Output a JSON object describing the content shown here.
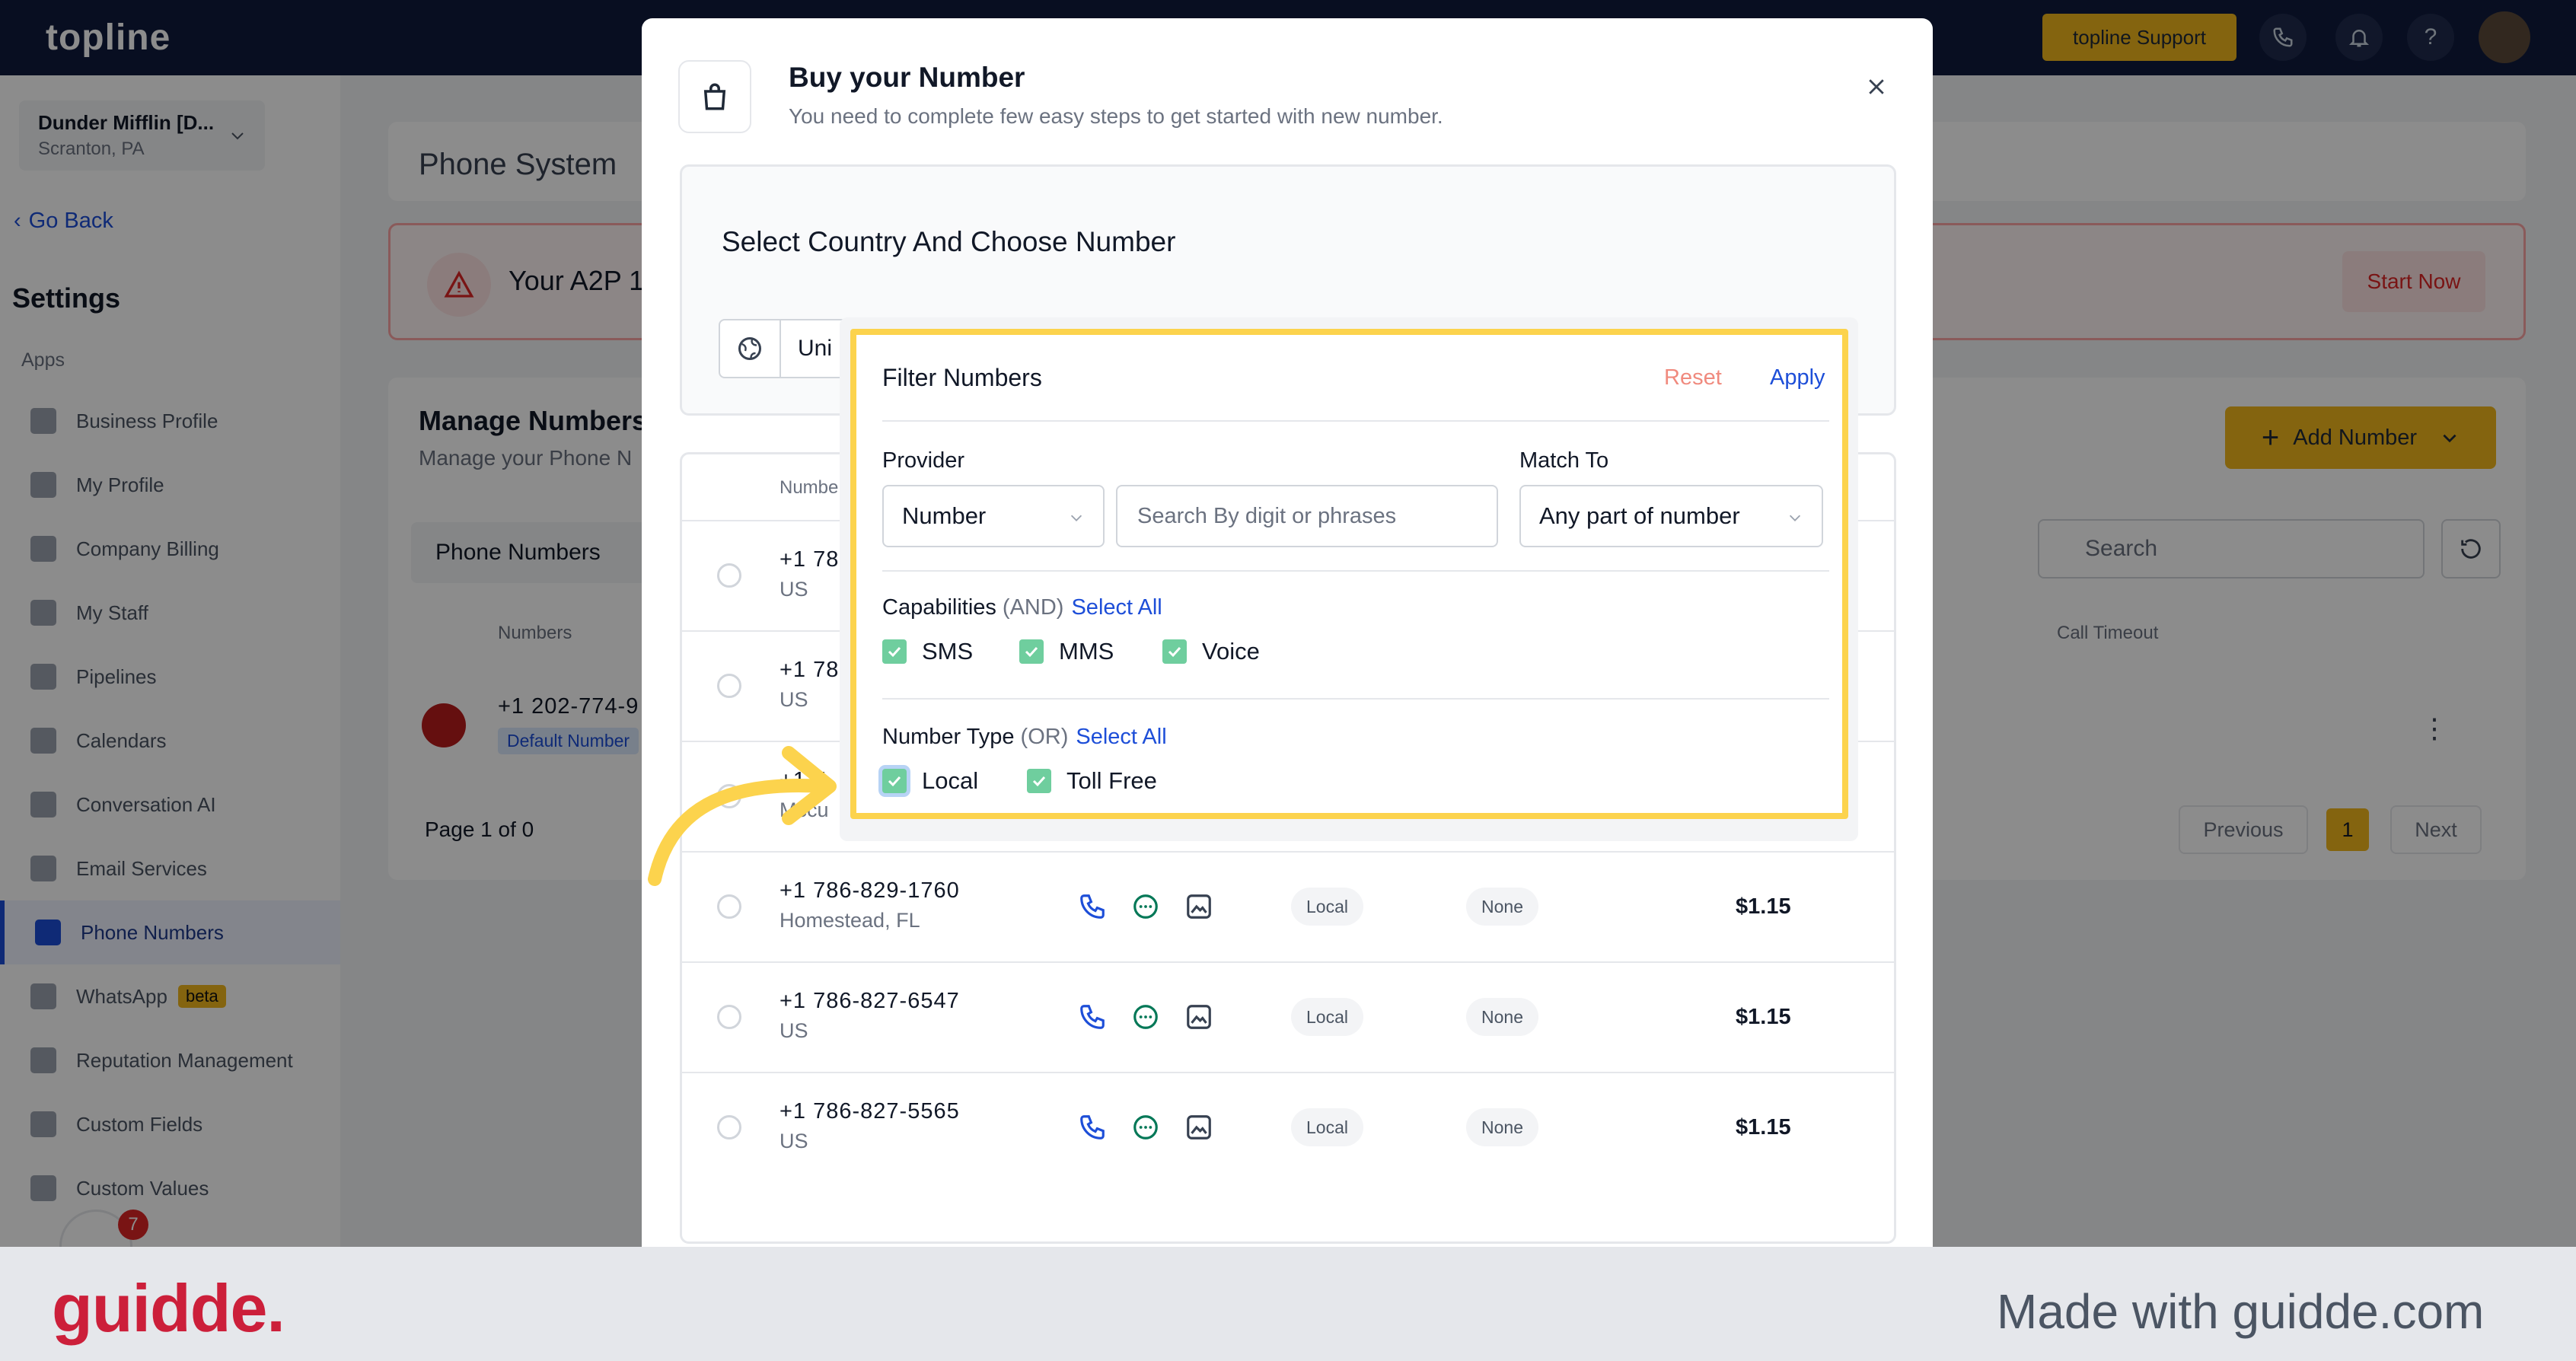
{
  "topbar": {
    "logo": "topline",
    "support_label": "topline Support"
  },
  "sidebar": {
    "account_name": "Dunder Mifflin [D...",
    "account_location": "Scranton, PA",
    "go_back": "Go Back",
    "settings_title": "Settings",
    "apps_label": "Apps",
    "items": [
      {
        "label": "Business Profile",
        "icon": "briefcase-icon"
      },
      {
        "label": "My Profile",
        "icon": "user-icon"
      },
      {
        "label": "Company Billing",
        "icon": "billing-icon"
      },
      {
        "label": "My Staff",
        "icon": "staff-icon"
      },
      {
        "label": "Pipelines",
        "icon": "pipeline-icon"
      },
      {
        "label": "Calendars",
        "icon": "calendar-icon"
      },
      {
        "label": "Conversation AI",
        "icon": "chat-icon"
      },
      {
        "label": "Email Services",
        "icon": "mail-icon"
      },
      {
        "label": "Phone Numbers",
        "icon": "phone-icon",
        "active": true
      },
      {
        "label": "WhatsApp",
        "icon": "whatsapp-icon",
        "badge": "beta"
      },
      {
        "label": "Reputation Management",
        "icon": "star-icon"
      },
      {
        "label": "Custom Fields",
        "icon": "edit-icon"
      },
      {
        "label": "Custom Values",
        "icon": "values-icon"
      }
    ],
    "notification_count": "7"
  },
  "background": {
    "page_title": "Phone System",
    "a2p_text": "Your A2P 1",
    "start_now": "Start Now",
    "manage_title": "Manage Numbers",
    "manage_sub": "Manage your Phone N",
    "add_number": "Add Number",
    "tab_phone_numbers": "Phone Numbers",
    "search_placeholder": "Search",
    "col_numbers": "Numbers",
    "col_call_timeout": "Call Timeout",
    "row_number": "+1 202-774-9",
    "row_badge": "Default Number",
    "pagination": {
      "page_text": "Page 1 of 0",
      "previous": "Previous",
      "current": "1",
      "next": "Next"
    }
  },
  "modal": {
    "title": "Buy your Number",
    "subtitle": "You need to complete few easy steps to get started with new number.",
    "step_title": "Select Country And Choose Number",
    "country_value": "Uni",
    "table_header_number": "Numbe",
    "rows_partial": [
      {
        "number": "+1 78",
        "location": "US"
      },
      {
        "number": "+1 78",
        "location": "US"
      },
      {
        "number": "+1 7",
        "location": "Mccu"
      }
    ],
    "rows": [
      {
        "number": "+1 786-829-1760",
        "location": "Homestead, FL",
        "type": "Local",
        "extra": "None",
        "price": "$1.15"
      },
      {
        "number": "+1 786-827-6547",
        "location": "US",
        "type": "Local",
        "extra": "None",
        "price": "$1.15"
      },
      {
        "number": "+1 786-827-5565",
        "location": "US",
        "type": "Local",
        "extra": "None",
        "price": "$1.15"
      }
    ]
  },
  "filter": {
    "title": "Filter Numbers",
    "reset": "Reset",
    "apply": "Apply",
    "provider_label": "Provider",
    "provider_value": "Number",
    "search_placeholder": "Search By digit or phrases",
    "match_label": "Match To",
    "match_value": "Any part of number",
    "capabilities_label": "Capabilities",
    "capabilities_hint": "(AND)",
    "capabilities_select_all": "Select All",
    "capabilities": [
      "SMS",
      "MMS",
      "Voice"
    ],
    "number_type_label": "Number Type",
    "number_type_hint": "(OR)",
    "number_type_select_all": "Select All",
    "number_types": [
      "Local",
      "Toll Free"
    ]
  },
  "footer": {
    "brand": "guidde.",
    "made_with": "Made with guidde.com"
  },
  "colors": {
    "accent": "#f0b71c",
    "link": "#1d4ed8",
    "highlight": "#fcd34d",
    "checkbox": "#6fce9e",
    "brand": "#cc1f3a"
  }
}
